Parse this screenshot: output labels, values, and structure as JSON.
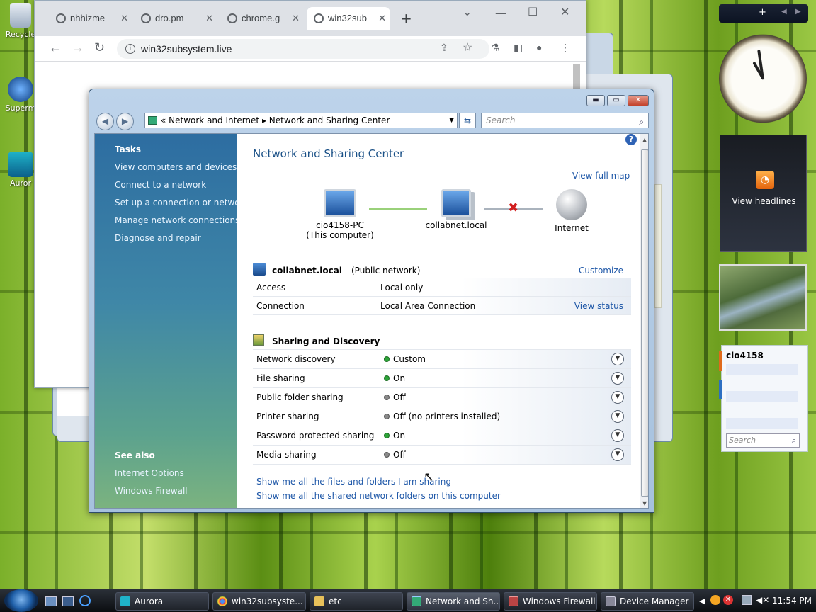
{
  "desktop": {
    "icons": [
      {
        "label": "Recycle"
      },
      {
        "label": "Superm"
      },
      {
        "label": "Auror"
      }
    ]
  },
  "chrome": {
    "tabs": [
      {
        "label": "nhhizme"
      },
      {
        "label": "dro.pm"
      },
      {
        "label": "chrome.g"
      },
      {
        "label": "win32sub"
      }
    ],
    "new_tab": "+",
    "url": "win32subsystem.live"
  },
  "window": {
    "breadcrumb": [
      "Network and Internet",
      "Network and Sharing Center"
    ],
    "search_placeholder": "Search",
    "title": "Network and Sharing Center",
    "view_full_map": "View full map",
    "tasks": {
      "heading": "Tasks",
      "items": [
        "View computers and devices",
        "Connect to a network",
        "Set up a connection or network",
        "Manage network connections",
        "Diagnose and repair"
      ]
    },
    "see_also": {
      "heading": "See also",
      "items": [
        "Internet Options",
        "Windows Firewall"
      ]
    },
    "map": {
      "computer": "cio4158-PC",
      "computer_sub": "(This computer)",
      "network": "collabnet.local",
      "internet": "Internet"
    },
    "network": {
      "name": "collabnet.local",
      "type": "(Public network)",
      "customize": "Customize",
      "rows": [
        {
          "label": "Access",
          "value": "Local only"
        },
        {
          "label": "Connection",
          "value": "Local Area Connection",
          "link": "View status"
        }
      ]
    },
    "sharing": {
      "heading": "Sharing and Discovery",
      "rows": [
        {
          "label": "Network discovery",
          "value": "Custom",
          "status": "on"
        },
        {
          "label": "File sharing",
          "value": "On",
          "status": "on"
        },
        {
          "label": "Public folder sharing",
          "value": "Off",
          "status": "off"
        },
        {
          "label": "Printer sharing",
          "value": "Off (no printers installed)",
          "status": "off"
        },
        {
          "label": "Password protected sharing",
          "value": "On",
          "status": "on"
        },
        {
          "label": "Media sharing",
          "value": "Off",
          "status": "off"
        }
      ]
    },
    "bottom_links": [
      "Show me all the files and folders I am sharing",
      "Show me all the shared network folders on this computer"
    ]
  },
  "gadgets": {
    "rss": "View headlines",
    "contacts_name": "cio4158",
    "contacts_search": "Search"
  },
  "taskbar": {
    "items": [
      {
        "label": "Aurora"
      },
      {
        "label": "win32subsyste..."
      },
      {
        "label": "etc"
      },
      {
        "label": "Network and Sh..."
      },
      {
        "label": "Windows Firewall"
      },
      {
        "label": "Device Manager"
      }
    ],
    "time": "11:54 PM"
  },
  "colors": {
    "status_on": "#2ea43a",
    "status_off": "#8a8a8a",
    "link": "#1f58a8"
  }
}
